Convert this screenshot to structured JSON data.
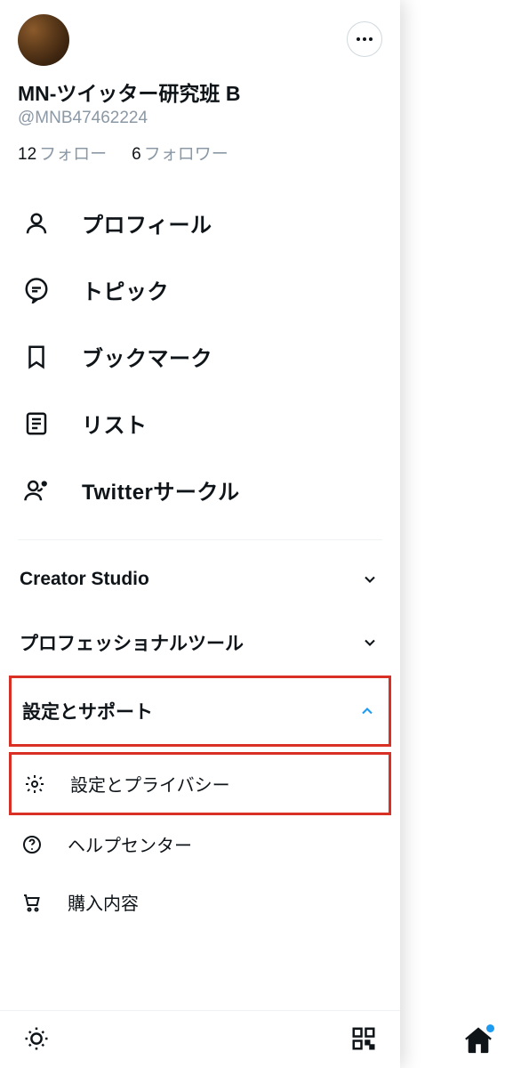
{
  "profile": {
    "display_name": "MN-ツイッター研究班 B",
    "handle": "@MNB47462224",
    "following_count": "12",
    "following_label": "フォロー",
    "followers_count": "6",
    "followers_label": "フォロワー"
  },
  "nav": [
    {
      "icon": "person-icon",
      "label": "プロフィール"
    },
    {
      "icon": "topic-icon",
      "label": "トピック"
    },
    {
      "icon": "bookmark-icon",
      "label": "ブックマーク"
    },
    {
      "icon": "list-icon",
      "label": "リスト"
    },
    {
      "icon": "circle-icon",
      "label": "Twitterサークル"
    }
  ],
  "sections": {
    "creator_studio": {
      "label": "Creator Studio",
      "expanded": false
    },
    "pro_tools": {
      "label": "プロフェッショナルツール",
      "expanded": false
    },
    "settings_support": {
      "label": "設定とサポート",
      "expanded": true
    }
  },
  "settings_items": [
    {
      "icon": "gear-icon",
      "label": "設定とプライバシー",
      "highlighted": true
    },
    {
      "icon": "help-icon",
      "label": "ヘルプセンター",
      "highlighted": false
    },
    {
      "icon": "cart-icon",
      "label": "購入内容",
      "highlighted": false
    }
  ],
  "bottom": {
    "theme_icon": "sun-icon",
    "qr_icon": "qr-icon"
  },
  "background": {
    "home_icon": "home-icon"
  },
  "highlights": {
    "settings_support_section": true,
    "settings_privacy_item": true
  }
}
